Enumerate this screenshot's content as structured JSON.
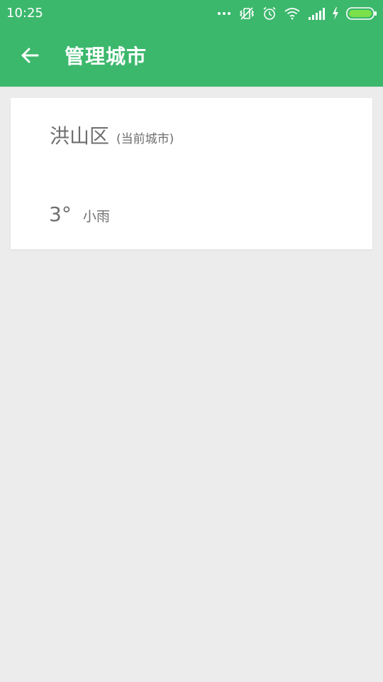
{
  "status_bar": {
    "time": "10:25",
    "icons": [
      "more-dots-icon",
      "vibrate-off-icon",
      "alarm-icon",
      "wifi-icon",
      "signal-icon",
      "charging-icon",
      "battery-icon"
    ]
  },
  "app_bar": {
    "title": "管理城市",
    "back_icon": "arrow-left-icon"
  },
  "cities": [
    {
      "name": "洪山区",
      "tag": "(当前城市)",
      "temperature": "3°",
      "condition": "小雨"
    }
  ],
  "colors": {
    "primary": "#3cb86d",
    "background": "#ececec",
    "card": "#ffffff",
    "text": "#6e6e6e",
    "battery": "#7be04a"
  }
}
